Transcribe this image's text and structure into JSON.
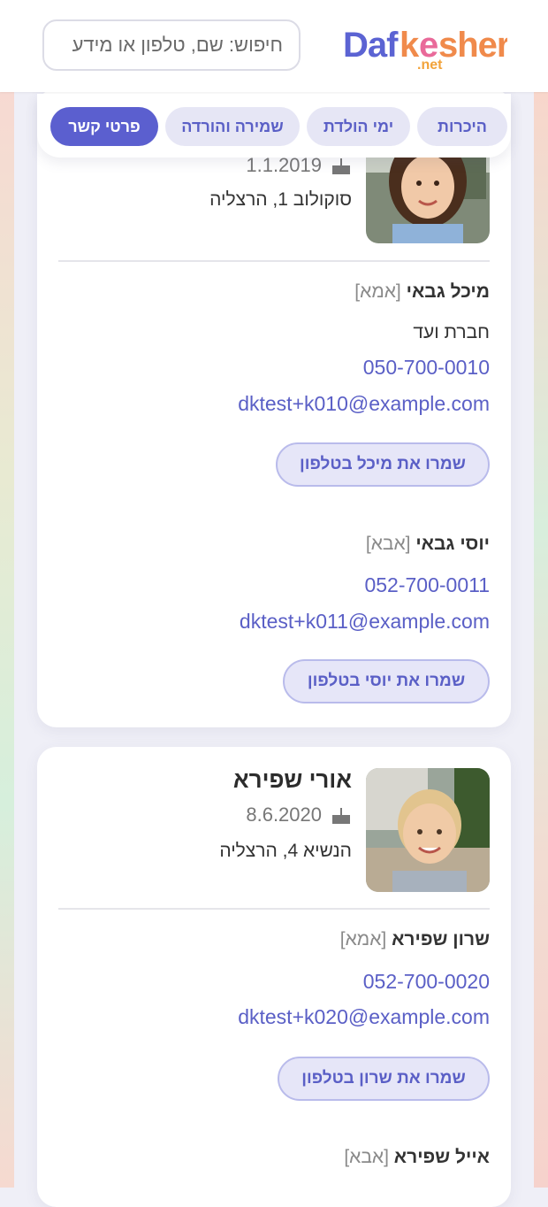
{
  "header": {
    "search_placeholder": "חיפוש: שם, טלפון או מידע",
    "logo_text_main": "Dafkesher",
    "logo_text_sub": ".net"
  },
  "tabs": [
    {
      "label": "היכרות",
      "active": false
    },
    {
      "label": "ימי הולדת",
      "active": false
    },
    {
      "label": "שמירה והורדה",
      "active": false
    },
    {
      "label": "פרטי קשר",
      "active": true
    }
  ],
  "cards": [
    {
      "child": {
        "birthdate": "1.1.2019",
        "address": "סוקולוב 1, הרצליה"
      },
      "parents": [
        {
          "name": "מיכל גבאי",
          "role": "[אמא]",
          "workplace": "חברת ועד",
          "phone": "050-700-0010",
          "email": "dktest+k010@example.com",
          "save_label": "שמרו את מיכל בטלפון"
        },
        {
          "name": "יוסי גבאי",
          "role": "[אבא]",
          "phone": "052-700-0011",
          "email": "dktest+k011@example.com",
          "save_label": "שמרו את יוסי בטלפון"
        }
      ]
    },
    {
      "child": {
        "name": "אורי שפירא",
        "birthdate": "8.6.2020",
        "address": "הנשיא 4, הרצליה"
      },
      "parents": [
        {
          "name": "שרון שפירא",
          "role": "[אמא]",
          "phone": "052-700-0020",
          "email": "dktest+k020@example.com",
          "save_label": "שמרו את שרון בטלפון"
        },
        {
          "name": "אייל שפירא",
          "role": "[אבא]"
        }
      ]
    }
  ],
  "colors": {
    "accent": "#5b5fcf",
    "link": "#5a5fc6",
    "logo_blue": "#5b63d3",
    "logo_orange": "#f08a4b"
  },
  "icons": [
    "search-icon",
    "birthday-cake-icon"
  ]
}
